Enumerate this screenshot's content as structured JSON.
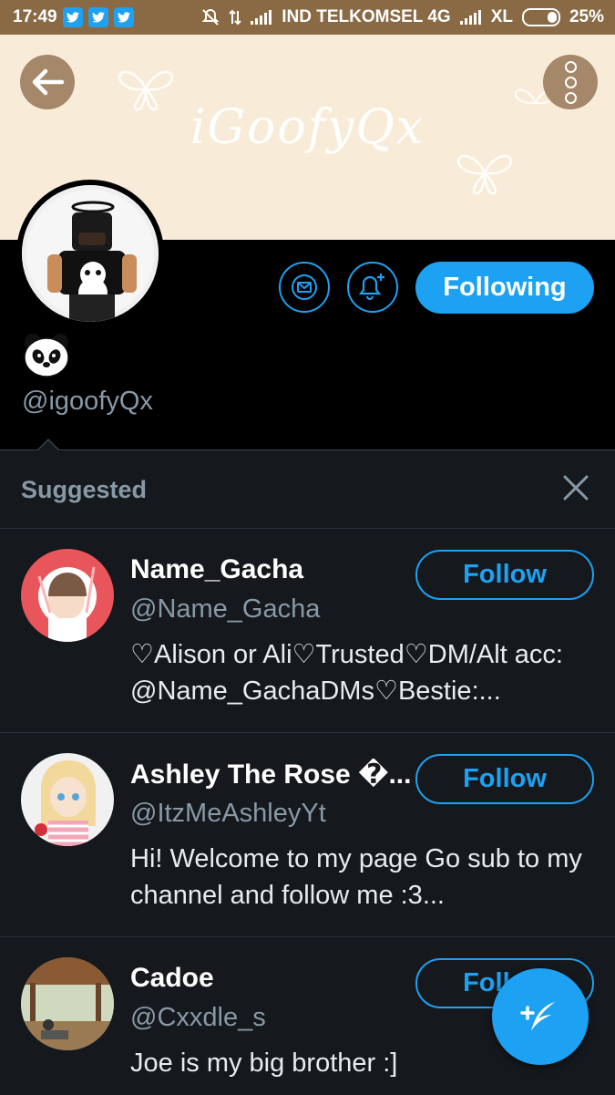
{
  "status": {
    "time": "17:49",
    "carrier": "IND TELKOMSEL 4G",
    "carrier2": "XL",
    "battery": "25%"
  },
  "banner": {
    "title": "iGoofyQx"
  },
  "profile": {
    "emoji": "🐼",
    "handle": "@igoofyQx",
    "following_label": "Following"
  },
  "suggested": {
    "title": "Suggested",
    "items": [
      {
        "name": "Name_Gacha",
        "handle": "@Name_Gacha",
        "bio": "♡Alison or Ali♡Trusted♡DM/Alt acc: @Name_GachaDMs♡Bestie:...",
        "button": "Follow"
      },
      {
        "name": "Ashley The Rose �...",
        "handle": "@ItzMeAshleyYt",
        "bio": "Hi! Welcome to my page Go sub to my channel and follow me :3...",
        "button": "Follow"
      },
      {
        "name": "Cadoe",
        "handle": "@Cxxdle_s",
        "bio": "Joe is my big brother :]",
        "button": "Follow"
      }
    ]
  },
  "colors": {
    "accent": "#1da1f2",
    "background": "#15181c",
    "banner": "#f8ecd8"
  }
}
